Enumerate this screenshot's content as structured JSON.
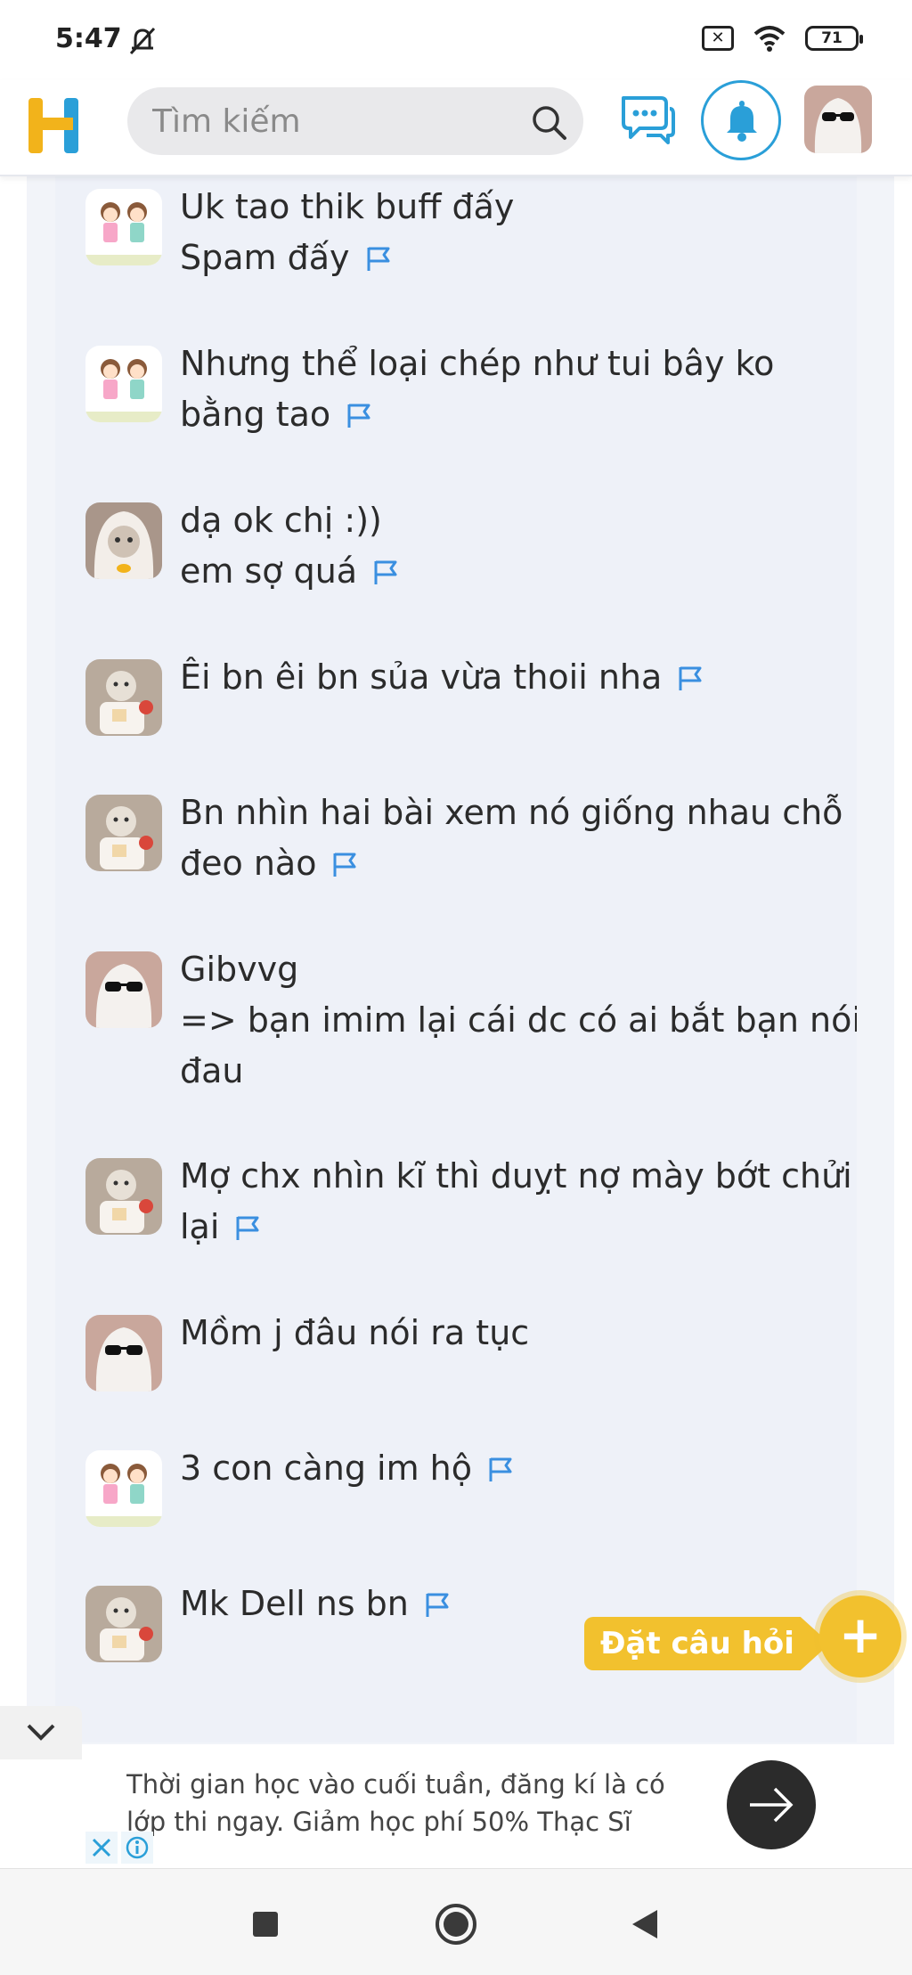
{
  "status_bar": {
    "time": "5:47",
    "battery": "71"
  },
  "header": {
    "logo": "H",
    "search_placeholder": "Tìm kiếm",
    "icons": [
      "search-icon",
      "chat-icon",
      "bell-icon",
      "avatar"
    ]
  },
  "comments": [
    {
      "avatar": "twins",
      "lines": [
        "Uk tao thik buff đấy",
        "Spam đấy"
      ],
      "flag": true
    },
    {
      "avatar": "twins",
      "lines": [
        "Nhưng thể loại chép như tui bây ko",
        "bằng tao"
      ],
      "flag": true
    },
    {
      "avatar": "cat-veil",
      "lines": [
        "dạ ok chị :))",
        "em sợ quá"
      ],
      "flag": true
    },
    {
      "avatar": "cat-bear",
      "lines": [
        "Êi bn êi bn sủa vừa thoii nha"
      ],
      "flag": true
    },
    {
      "avatar": "cat-bear",
      "lines": [
        "Bn nhìn hai bài xem nó giống nhau chỗ",
        "đeo nào"
      ],
      "flag": true
    },
    {
      "avatar": "ghost",
      "lines": [
        "Gibvvg",
        "=> bạn imim lại cái dc có ai bắt bạn nói",
        "đau"
      ],
      "flag": false
    },
    {
      "avatar": "cat-bear",
      "lines": [
        "Mợ chx nhìn kĩ thì duỵt nợ mày bớt chửi",
        "lại"
      ],
      "flag": true
    },
    {
      "avatar": "ghost",
      "lines": [
        "Mồm j đâu nói ra tục"
      ],
      "flag": false
    },
    {
      "avatar": "twins",
      "lines": [
        "3 con càng im hộ"
      ],
      "flag": true
    },
    {
      "avatar": "cat-bear",
      "lines": [
        "Mk Dell ns bn"
      ],
      "flag": true
    }
  ],
  "ask_button": {
    "label": "Đặt câu hỏi",
    "icon": "+"
  },
  "ad": {
    "text_line1": "Thời gian học vào cuối tuần, đăng kí là có",
    "text_line2": "lớp thi ngay. Giảm học phí 50% Thạc Sĩ"
  },
  "colors": {
    "accent_blue": "#2a9fd8",
    "ask_yellow": "#f2c12e",
    "panel_bg": "#eef1f8",
    "flag_blue": "#3a8fe0"
  }
}
